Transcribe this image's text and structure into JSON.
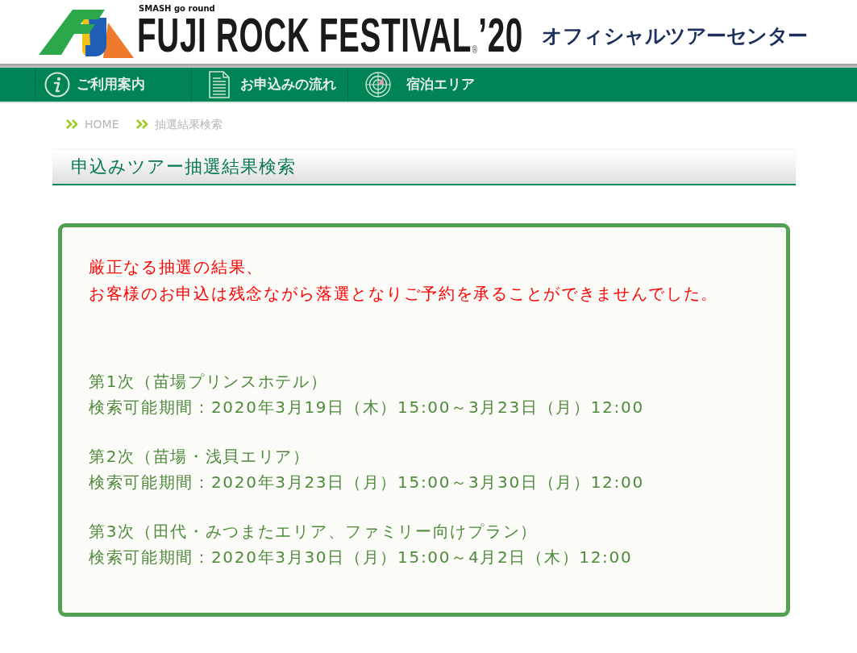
{
  "header": {
    "tagline": "SMASH go round",
    "title": "FUJI ROCK FESTIVAL",
    "registered": "®",
    "year": "’20",
    "subtitle": "オフィシャルツアーセンター"
  },
  "nav": [
    {
      "kind": "info",
      "label": "ご利用案内"
    },
    {
      "kind": "document",
      "label": "お申込みの流れ"
    },
    {
      "kind": "target",
      "label": "宿泊エリア"
    }
  ],
  "breadcrumb": [
    "HOME",
    "抽選結果検索"
  ],
  "heading": "申込みツアー抽選結果検索",
  "result": {
    "message": [
      "厳正なる抽選の結果、",
      "お客様のお申込は残念ながら落選となりご予約を承ることができませんでした。"
    ],
    "rounds": [
      {
        "title": "第1次（苗場プリンスホテル）",
        "period": "検索可能期間：2020年3月19日（木）15:00～3月23日（月）12:00"
      },
      {
        "title": "第2次（苗場・浅貝エリア）",
        "period": "検索可能期間：2020年3月23日（月）15:00～3月30日（月）12:00"
      },
      {
        "title": "第3次（田代・みつまたエリア、ファミリー向けプラン）",
        "period": "検索可能期間：2020年3月30日（月）15:00～4月2日（木）12:00"
      }
    ]
  }
}
